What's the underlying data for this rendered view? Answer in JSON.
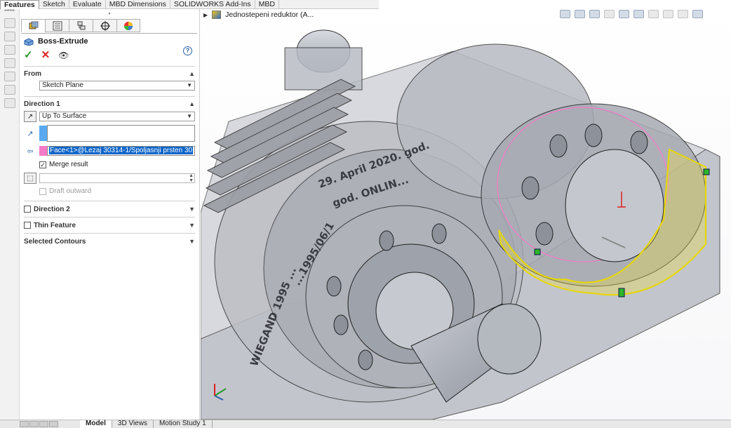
{
  "command_tabs": [
    "Features",
    "Sketch",
    "Evaluate",
    "MBD Dimensions",
    "SOLIDWORKS Add-Ins",
    "MBD"
  ],
  "property_manager": {
    "title": "Boss-Extrude",
    "help": "?",
    "from": {
      "label": "From",
      "value": "Sketch Plane"
    },
    "direction1": {
      "label": "Direction 1",
      "end_condition": "Up To Surface",
      "face_selection": "Face<1>@Lezaj 30314-1/Spoljasnji prsten 30",
      "merge_result": "Merge result",
      "draft_outward": "Draft outward"
    },
    "direction2_label": "Direction 2",
    "thin_feature_label": "Thin Feature",
    "selected_contours_label": "Selected Contours"
  },
  "feature_tree": {
    "root": "Jednostepeni reduktor  (A..."
  },
  "model_engraving": [
    "29. April 2020. god.",
    "god. ONLIN...",
    "WIEGAND 1995 ...",
    "...1995/06/1"
  ],
  "bottom_tabs": [
    "Model",
    "3D Views",
    "Motion Study 1"
  ],
  "colors": {
    "accent_blue": "#0a64c8",
    "selection_pink": "#f57ac8",
    "direction_blue": "#5aa9f0",
    "preview_yellow": "#f0e040",
    "ok_green": "#2a9a2a",
    "cancel_red": "#dd2222"
  }
}
